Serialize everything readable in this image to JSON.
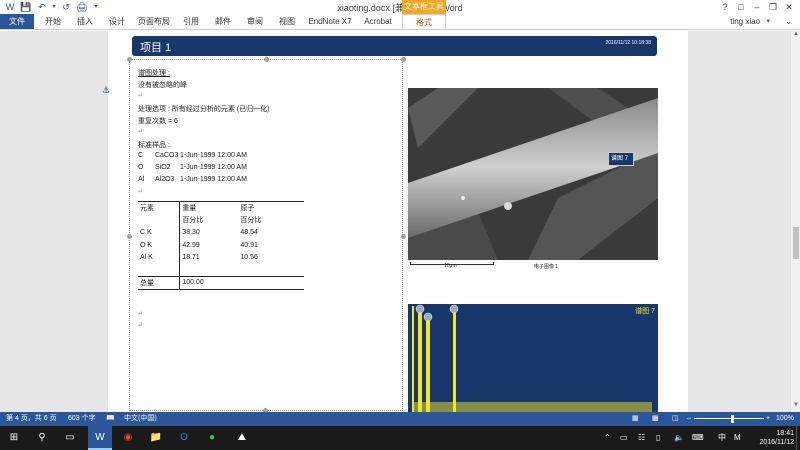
{
  "window": {
    "title": "xiaoting.docx [兼容模式] - Word",
    "contextual_tab_group": "文本框工具",
    "help": "?"
  },
  "ribbon": {
    "tabs": [
      "文件",
      "开始",
      "插入",
      "设计",
      "页面布局",
      "引用",
      "邮件",
      "审阅",
      "视图",
      "EndNote X7",
      "Acrobat",
      "格式"
    ],
    "active_tab": "格式",
    "user": "ting xiao"
  },
  "document": {
    "header": {
      "project_label": "项目 1",
      "timestamp": "2016/11/12 10:18:38"
    },
    "textbox": {
      "spectrum_processing_title": "谱图处理 :",
      "no_peaks_omitted": "没有被忽略的峰",
      "processing_option": "处理选项 : 所有经过分析的元素 (已归一化)",
      "iterations": "重复次数 = 6",
      "standards_title": "标准样品 :",
      "standards": [
        {
          "element": "C",
          "compound": "CaCO3",
          "date": "1-Jun-1999 12:00 AM"
        },
        {
          "element": "O",
          "compound": "SiO2",
          "date": "1-Jun-1999 12:00 AM"
        },
        {
          "element": "Al",
          "compound": "Al2O3",
          "date": "1-Jun-1999 12:00 AM"
        }
      ]
    },
    "table": {
      "headers": [
        "元素",
        "重量",
        "原子"
      ],
      "subheaders": [
        "",
        "百分比",
        "百分比"
      ],
      "rows": [
        {
          "element": "C K",
          "weight": "38.30",
          "atomic": "48.54"
        },
        {
          "element": "O K",
          "weight": "42.99",
          "atomic": "40.91"
        },
        {
          "element": "Al K",
          "weight": "18.71",
          "atomic": "10.56"
        }
      ],
      "total_label": "总量",
      "total_value": "100.00"
    },
    "sem_image": {
      "spectrum_tag": "谱图 7",
      "scale_bar": "10μm",
      "caption": "电子图像 1"
    },
    "spectrum": {
      "label": "谱图 7"
    }
  },
  "statusbar": {
    "page": "第 4 页，共 6 页",
    "words": "603 个字",
    "language": "中文(中国)",
    "zoom": "100%",
    "zoom_fraction": 0.5
  },
  "taskbar": {
    "ime": "中",
    "ime_mode": "M",
    "time": "18:41",
    "date": "2016/11/12"
  },
  "colors": {
    "word_blue": "#2b579a",
    "header_navy": "#17376b",
    "context_tab": "#f5a623",
    "spectrum_yellow": "#f5e52a"
  }
}
